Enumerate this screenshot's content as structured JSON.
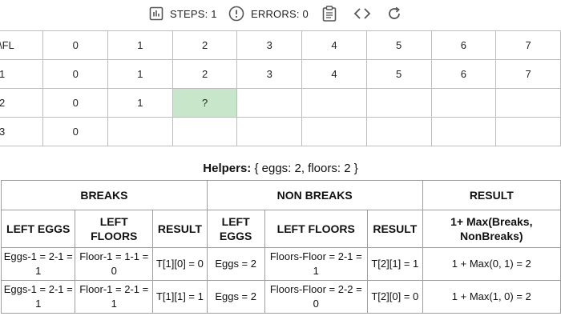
{
  "toolbar": {
    "steps_label": "STEPS: 1",
    "errors_label": "ERRORS: 0",
    "icons": [
      "chart-icon",
      "alert-icon",
      "clipboard-icon",
      "code-icon",
      "refresh-icon"
    ]
  },
  "dp_table": {
    "header": [
      "\\FL",
      "0",
      "1",
      "2",
      "3",
      "4",
      "5",
      "6",
      "7"
    ],
    "rows": [
      [
        "1",
        "0",
        "1",
        "2",
        "3",
        "4",
        "5",
        "6",
        "7"
      ],
      [
        "2",
        "0",
        "1",
        "?",
        "",
        "",
        "",
        "",
        ""
      ],
      [
        "3",
        "0",
        "",
        "",
        "",
        "",
        "",
        "",
        ""
      ]
    ],
    "highlight_color": "#c8e6c9"
  },
  "helpers": {
    "title_bold": "Helpers:",
    "title_rest": " { eggs: 2, floors: 2 }",
    "groups": {
      "breaks": "BREAKS",
      "non_breaks": "NON BREAKS",
      "result": "RESULT"
    },
    "columns": {
      "left_eggs": "LEFT EGGS",
      "left_floors": "LEFT FLOORS",
      "result": "RESULT",
      "nb_left_eggs": "LEFT EGGS",
      "nb_left_floors": "LEFT FLOORS",
      "nb_result": "RESULT",
      "final": "1+ Max(Breaks, NonBreaks)"
    },
    "rows": [
      {
        "left_eggs": "Eggs-1 = 2-1 = 1",
        "left_floors": "Floor-1 = 1-1 = 0",
        "result": "T[1][0] = 0",
        "nb_left_eggs": "Eggs = 2",
        "nb_left_floors": "Floors-Floor = 2-1 = 1",
        "nb_result": "T[2][1] = 1",
        "final": "1 + Max(0, 1) = 2"
      },
      {
        "left_eggs": "Eggs-1 = 2-1 = 1",
        "left_floors": "Floor-1 = 2-1 = 1",
        "result": "T[1][1] = 1",
        "nb_left_eggs": "Eggs = 2",
        "nb_left_floors": "Floors-Floor = 2-2 = 0",
        "nb_result": "T[2][0] = 0",
        "final": "1 + Max(1, 0) = 2"
      }
    ]
  }
}
